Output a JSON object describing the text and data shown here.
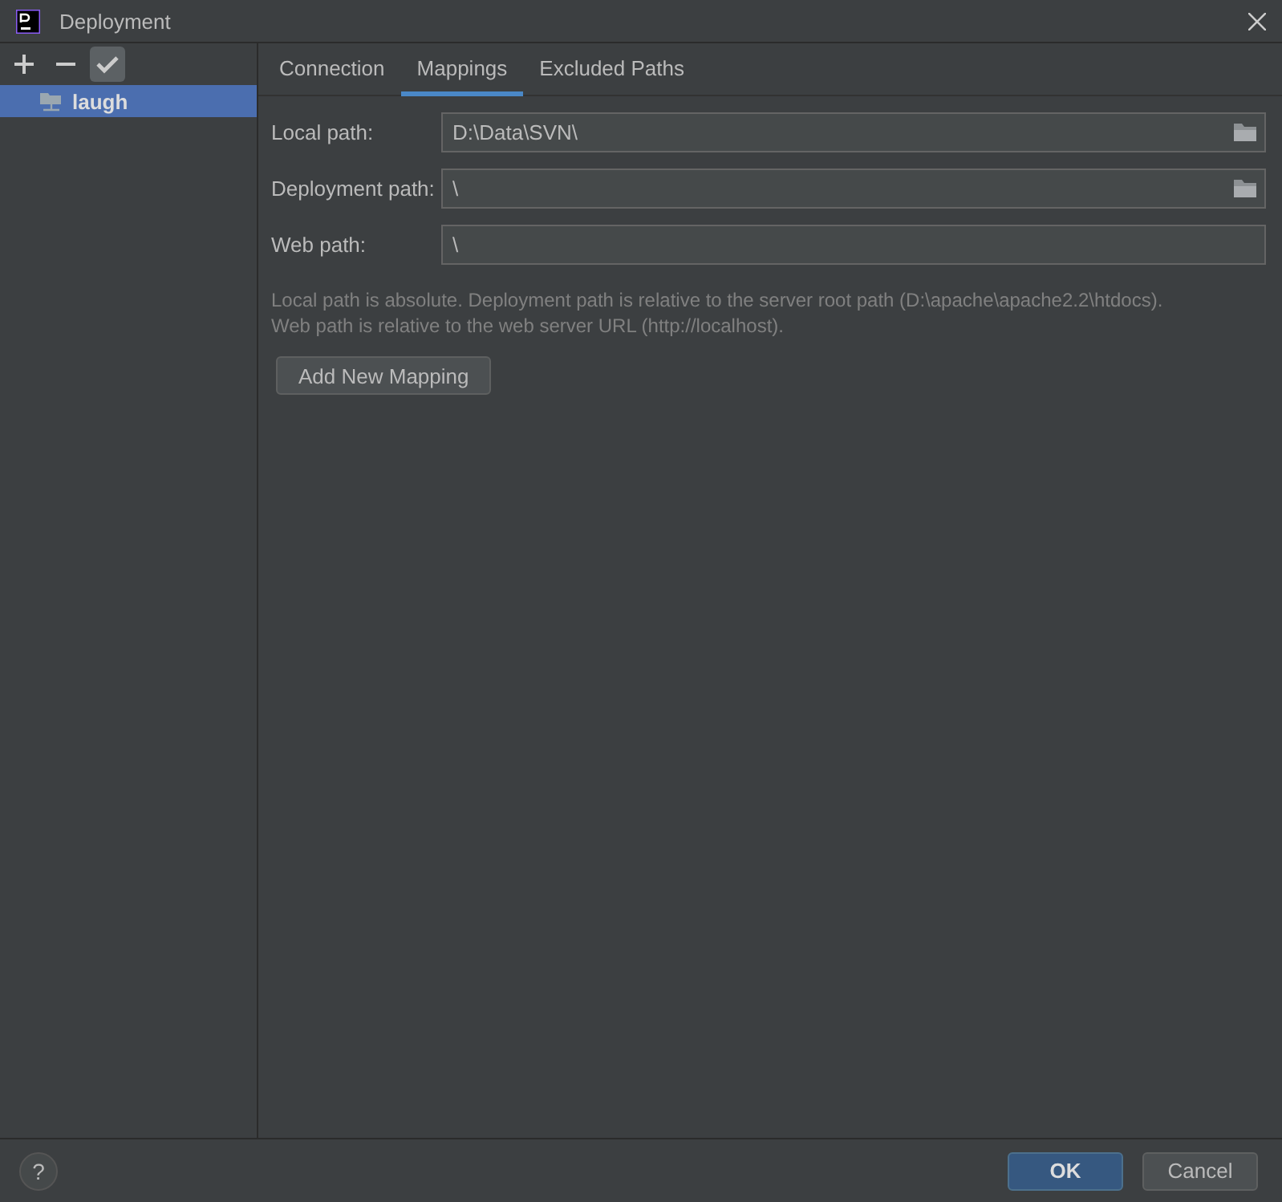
{
  "window": {
    "title": "Deployment"
  },
  "sidebar": {
    "toolbar": [
      {
        "kind": "add"
      },
      {
        "kind": "remove"
      },
      {
        "kind": "default",
        "selected": true
      }
    ],
    "items": [
      {
        "label": "laugh",
        "selected": true
      }
    ]
  },
  "tabs": [
    {
      "label": "Connection",
      "selected": false
    },
    {
      "label": "Mappings",
      "selected": true
    },
    {
      "label": "Excluded Paths",
      "selected": false
    }
  ],
  "fields": [
    {
      "label": "Local path:",
      "value": "D:\\Data\\SVN\\",
      "browse": true
    },
    {
      "label": "Deployment path:",
      "value": "\\",
      "browse": true
    },
    {
      "label": "Web path:",
      "value": "\\",
      "browse": false
    }
  ],
  "hint": [
    "Local path is absolute. Deployment path is relative to the server root path (D:\\apache\\apache2.2\\htdocs).",
    "Web path is relative to the web server URL (http://localhost)."
  ],
  "add_button": "Add New Mapping",
  "footer": {
    "help": "?",
    "buttons": [
      {
        "label": "OK",
        "kind": "primary"
      },
      {
        "label": "Cancel",
        "kind": "normal"
      }
    ]
  }
}
